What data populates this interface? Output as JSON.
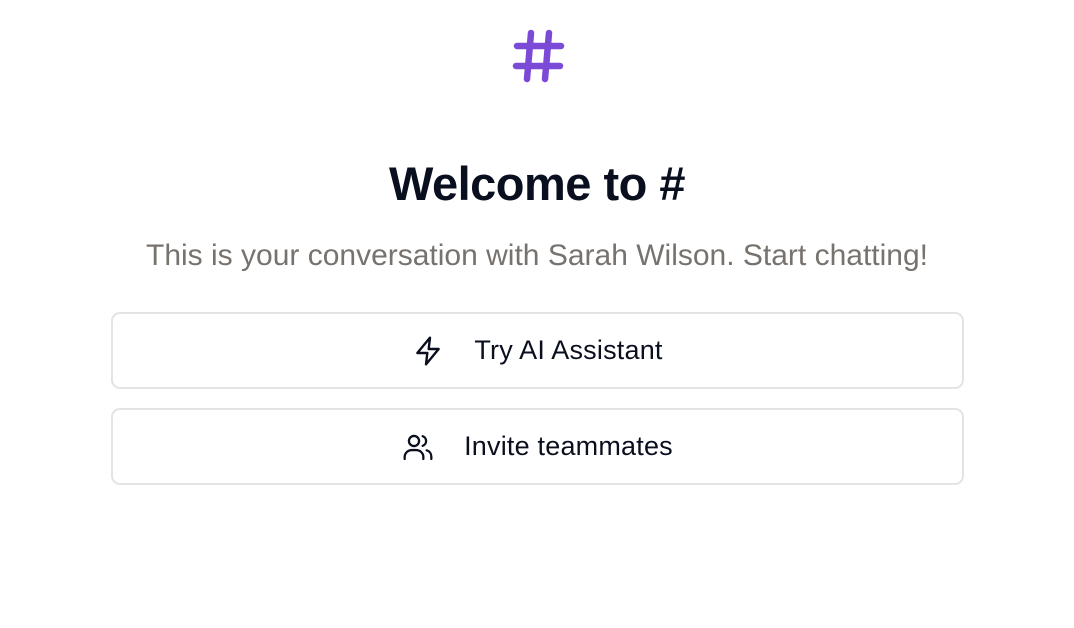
{
  "logo": {
    "icon": "hash-icon",
    "color": "#7b4ad6"
  },
  "welcome": {
    "title": "Welcome to #",
    "subtitle": "This is your conversation with Sarah Wilson. Start chatting!"
  },
  "actions": [
    {
      "label": "Try AI Assistant",
      "icon": "lightning-icon"
    },
    {
      "label": "Invite teammates",
      "icon": "users-icon"
    }
  ]
}
